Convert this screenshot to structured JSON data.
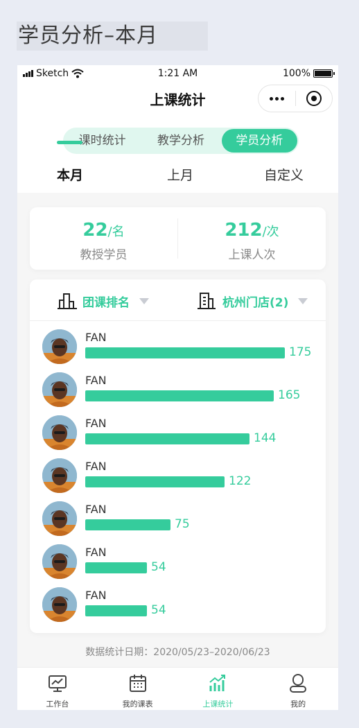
{
  "page": {
    "title": "学员分析–本月"
  },
  "status_bar": {
    "carrier": "Sketch",
    "time": "1:21 AM",
    "battery": "100%"
  },
  "navbar": {
    "title": "上课统计"
  },
  "segment": {
    "items": [
      "课时统计",
      "教学分析",
      "学员分析"
    ],
    "active_index": 2
  },
  "period_tabs": {
    "items": [
      "本月",
      "上月",
      "自定义"
    ],
    "active_index": 0
  },
  "summary": {
    "students": {
      "value": "22",
      "unit": "/名",
      "label": "教授学员"
    },
    "sessions": {
      "value": "212",
      "unit": "/次",
      "label": "上课人次"
    }
  },
  "filters": {
    "ranking": "团课排名",
    "store": "杭州门店(2)"
  },
  "ranking": [
    {
      "name": "FAN",
      "value": 175
    },
    {
      "name": "FAN",
      "value": 165
    },
    {
      "name": "FAN",
      "value": 144
    },
    {
      "name": "FAN",
      "value": 122
    },
    {
      "name": "FAN",
      "value": 75
    },
    {
      "name": "FAN",
      "value": 54
    },
    {
      "name": "FAN",
      "value": 54
    }
  ],
  "date_range": "数据统计日期：2020/05/23–2020/06/23",
  "tabbar": {
    "items": [
      {
        "label": "工作台",
        "icon": "monitor-chart-icon"
      },
      {
        "label": "我的课表",
        "icon": "calendar-icon"
      },
      {
        "label": "上课统计",
        "icon": "bar-trend-icon"
      },
      {
        "label": "我的",
        "icon": "person-icon"
      }
    ],
    "active_index": 2
  },
  "colors": {
    "accent": "#35cc9c",
    "accent_light": "#e0f7ef",
    "background": "#f6f6f6"
  }
}
